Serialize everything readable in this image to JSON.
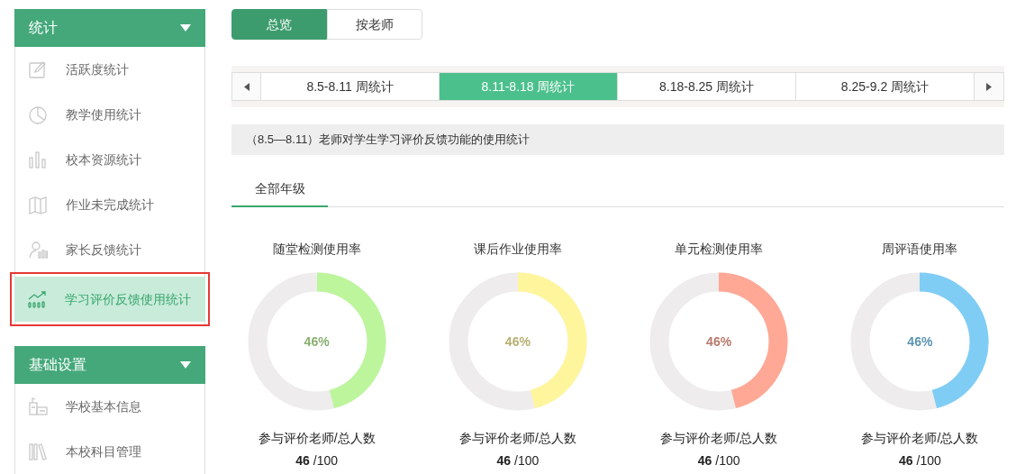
{
  "sidebar": {
    "sections": [
      {
        "title": "统计",
        "expanded": true,
        "items": [
          {
            "label": "活跃度统计",
            "selected": false,
            "highlighted": false
          },
          {
            "label": "教学使用统计",
            "selected": false,
            "highlighted": false
          },
          {
            "label": "校本资源统计",
            "selected": false,
            "highlighted": false
          },
          {
            "label": "作业未完成统计",
            "selected": false,
            "highlighted": false
          },
          {
            "label": "家长反馈统计",
            "selected": false,
            "highlighted": false
          },
          {
            "label": "学习评价反馈使用统计",
            "selected": true,
            "highlighted": true
          }
        ]
      },
      {
        "title": "基础设置",
        "expanded": true,
        "items": [
          {
            "label": "学校基本信息",
            "selected": false,
            "highlighted": false
          },
          {
            "label": "本校科目管理",
            "selected": false,
            "highlighted": false
          }
        ]
      }
    ]
  },
  "view_tabs": [
    {
      "label": "总览",
      "selected": true
    },
    {
      "label": "按老师",
      "selected": false
    }
  ],
  "week_tabs": [
    {
      "label": "8.5-8.11 周统计",
      "selected": false
    },
    {
      "label": "8.11-8.18 周统计",
      "selected": true
    },
    {
      "label": "8.18-8.25 周统计",
      "selected": false
    },
    {
      "label": "8.25-9.2 周统计",
      "selected": false
    }
  ],
  "section_title": "（8.5—8.11）老师对学生学习评价反馈功能的使用统计",
  "grade_tabs": [
    {
      "label": "全部年级",
      "selected": true
    }
  ],
  "meters": [
    {
      "title": "随堂检测使用率",
      "level": 0.46,
      "reading": "46%",
      "color": "#bdf59c",
      "caption": "参与评价老师/总人数",
      "count": "46",
      "total": "/100"
    },
    {
      "title": "课后作业使用率",
      "level": 0.46,
      "reading": "46%",
      "color": "#fff59d",
      "caption": "参与评价老师/总人数",
      "count": "46",
      "total": "/100"
    },
    {
      "title": "单元检测使用率",
      "level": 0.46,
      "reading": "46%",
      "color": "#ffa896",
      "caption": "参与评价老师/总人数",
      "count": "46",
      "total": "/100"
    },
    {
      "title": "周评语使用率",
      "level": 0.46,
      "reading": "46%",
      "color": "#7fcdf5",
      "caption": "参与评价老师/总人数",
      "count": "46",
      "total": "/100"
    }
  ]
}
